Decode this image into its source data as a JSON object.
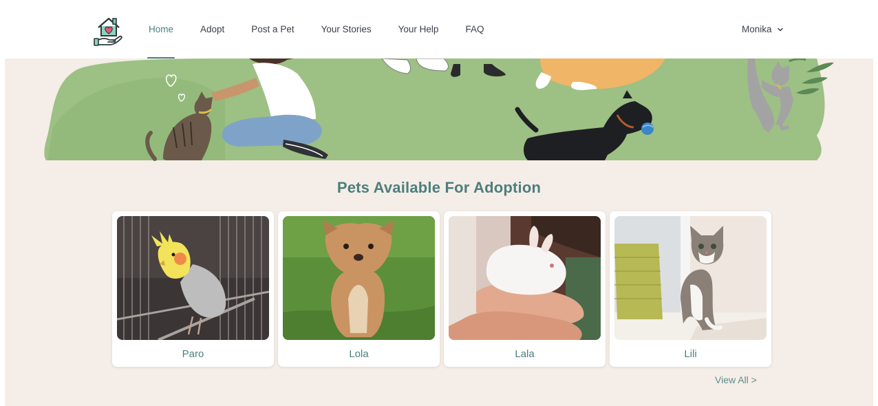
{
  "nav": {
    "logo_icon": "house-heart-hand-icon",
    "links": [
      {
        "label": "Home",
        "active": true
      },
      {
        "label": "Adopt",
        "active": false
      },
      {
        "label": "Post a Pet",
        "active": false
      },
      {
        "label": "Your Stories",
        "active": false
      },
      {
        "label": "Your Help",
        "active": false
      },
      {
        "label": "FAQ",
        "active": false
      }
    ],
    "user": {
      "name": "Monika",
      "icon": "chevron-down-icon"
    }
  },
  "hero": {
    "illustration": "girl-petting-cat-and-dogs-on-grass"
  },
  "section": {
    "title": "Pets Available For Adoption",
    "pets": [
      {
        "name": "Paro",
        "photo": "cockatiel-in-cage"
      },
      {
        "name": "Lola",
        "photo": "chihuahua-on-grass"
      },
      {
        "name": "Lala",
        "photo": "white-bunny-in-hands"
      },
      {
        "name": "Lili",
        "photo": "tabby-kitten"
      }
    ],
    "view_all": "View All >"
  },
  "colors": {
    "accent": "#4b7f7d",
    "background": "#f5ede7",
    "grass": "#9dc084"
  }
}
